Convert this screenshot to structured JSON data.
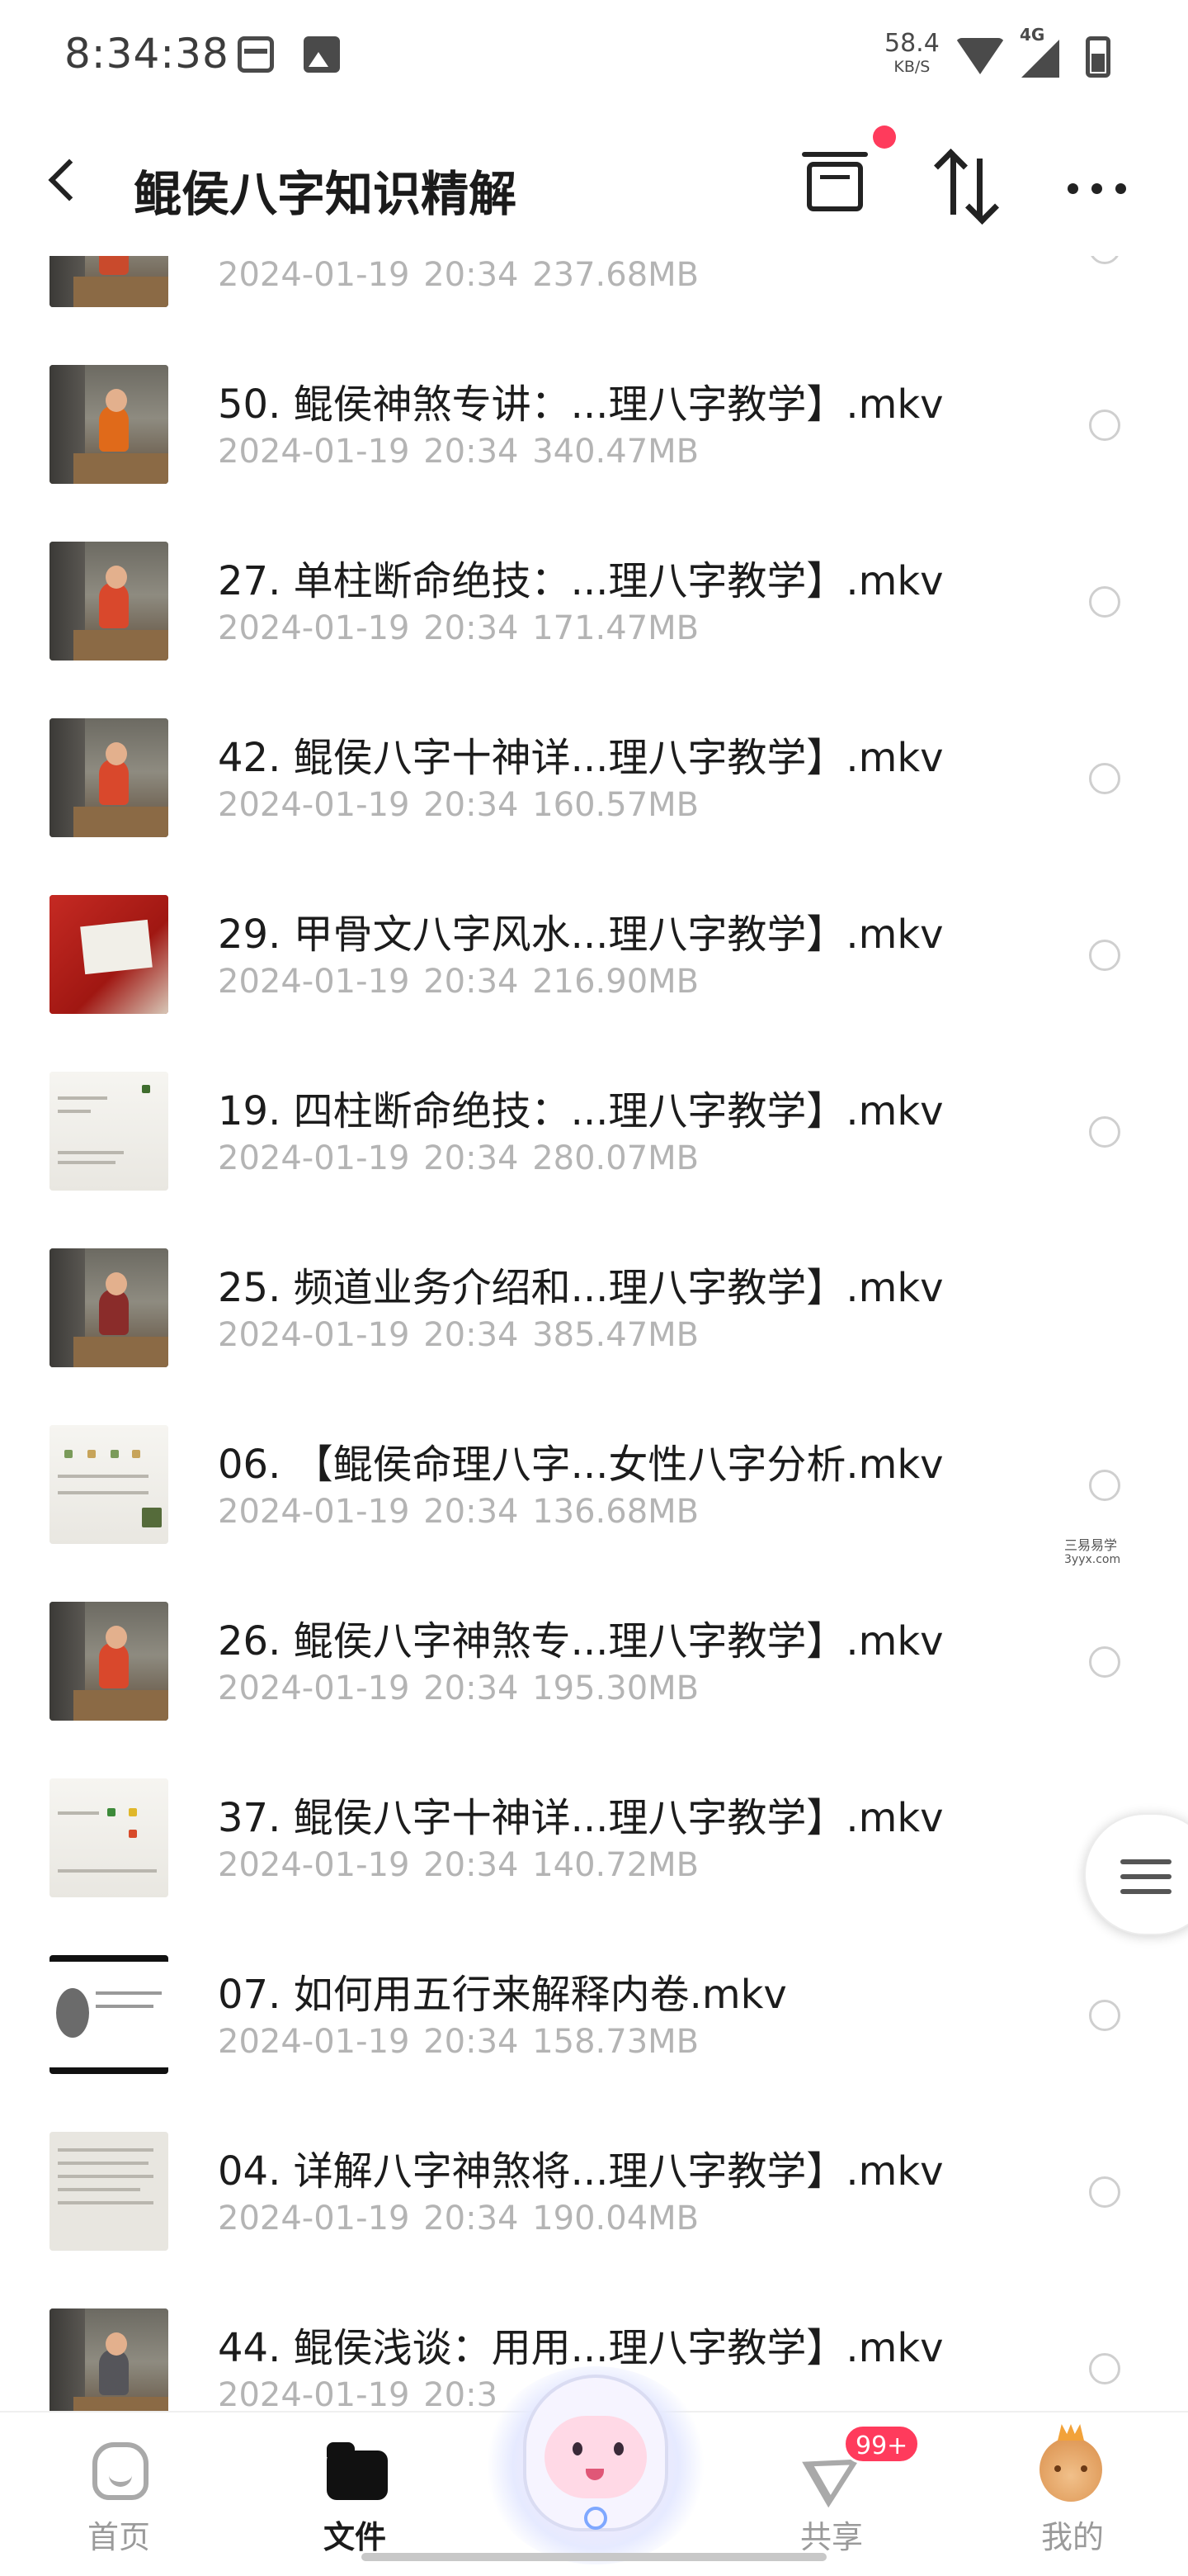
{
  "status_bar": {
    "time": "8:34:38",
    "net_speed": "58.4",
    "net_unit": "KB/S",
    "network": "4G",
    "icons": [
      "notification-box-icon",
      "image-icon",
      "wifi-icon",
      "signal-icon",
      "battery-icon"
    ]
  },
  "header": {
    "title": "鲲侯八字知识精解",
    "icons": [
      "back-icon",
      "transfer-box-icon",
      "sort-icon",
      "more-icon"
    ],
    "notification_dot_color": "#ff3b5c"
  },
  "files": [
    {
      "name": "",
      "date": "2024-01-19",
      "time": "20:34",
      "size": "237.68MB"
    },
    {
      "name": "50. 鲲侯神煞专讲：...理八字教学】.mkv",
      "date": "2024-01-19",
      "time": "20:34",
      "size": "340.47MB"
    },
    {
      "name": "27. 单柱断命绝技：...理八字教学】.mkv",
      "date": "2024-01-19",
      "time": "20:34",
      "size": "171.47MB"
    },
    {
      "name": "42. 鲲侯八字十神详...理八字教学】.mkv",
      "date": "2024-01-19",
      "time": "20:34",
      "size": "160.57MB"
    },
    {
      "name": "29. 甲骨文八字风水...理八字教学】.mkv",
      "date": "2024-01-19",
      "time": "20:34",
      "size": "216.90MB"
    },
    {
      "name": "19. 四柱断命绝技：...理八字教学】.mkv",
      "date": "2024-01-19",
      "time": "20:34",
      "size": "280.07MB"
    },
    {
      "name": "25. 频道业务介绍和...理八字教学】.mkv",
      "date": "2024-01-19",
      "time": "20:34",
      "size": "385.47MB"
    },
    {
      "name": "06. 【鲲侯命理八字...女性八字分析.mkv",
      "date": "2024-01-19",
      "time": "20:34",
      "size": "136.68MB"
    },
    {
      "name": "26. 鲲侯八字神煞专...理八字教学】.mkv",
      "date": "2024-01-19",
      "time": "20:34",
      "size": "195.30MB"
    },
    {
      "name": "37. 鲲侯八字十神详...理八字教学】.mkv",
      "date": "2024-01-19",
      "time": "20:34",
      "size": "140.72MB"
    },
    {
      "name": "07. 如何用五行来解释内卷.mkv",
      "date": "2024-01-19",
      "time": "20:34",
      "size": "158.73MB"
    },
    {
      "name": "04. 详解八字神煞将...理八字教学】.mkv",
      "date": "2024-01-19",
      "time": "20:34",
      "size": "190.04MB"
    },
    {
      "name": "44. 鲲侯浅谈：用用...理八字教学】.mkv",
      "date": "2024-01-19",
      "time": "20:3",
      "size": ""
    }
  ],
  "watermark": {
    "line1": "三易易学",
    "line2": "3yyx.com"
  },
  "bottom_nav": {
    "tabs": [
      {
        "label": "首页",
        "icon": "home-icon"
      },
      {
        "label": "文件",
        "icon": "folder-icon",
        "active": true
      },
      {
        "label": "共享",
        "icon": "share-icon",
        "badge": "99+"
      },
      {
        "label": "我的",
        "icon": "profile-avatar-icon"
      }
    ]
  },
  "colors": {
    "accent": "#ff3b5c",
    "meta_text": "#b4b4b4",
    "title_text": "#1b1b1b"
  }
}
